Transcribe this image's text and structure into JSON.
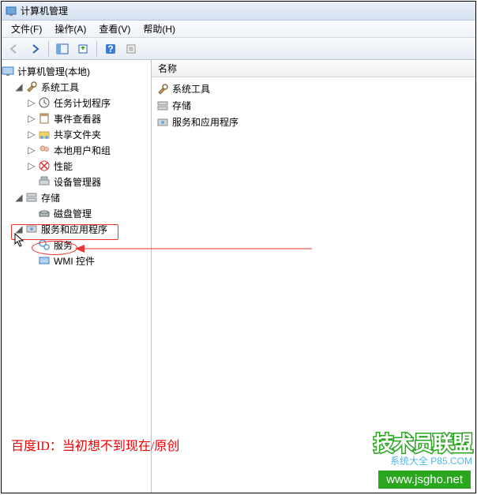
{
  "titlebar": {
    "text": "计算机管理"
  },
  "menu": {
    "file": "文件(F)",
    "action": "操作(A)",
    "view": "查看(V)",
    "help": "帮助(H)"
  },
  "tree": {
    "root": "计算机管理(本地)",
    "sys": "系统工具",
    "sys_children": {
      "sched": "任务计划程序",
      "evt": "事件查看器",
      "shared": "共享文件夹",
      "users": "本地用户和组",
      "perf": "性能",
      "devmgr": "设备管理器"
    },
    "storage": "存储",
    "storage_children": {
      "diskmgmt": "磁盘管理"
    },
    "svcapps": "服务和应用程序",
    "svcapps_children": {
      "services": "服务",
      "wmi": "WMI 控件"
    }
  },
  "right": {
    "header": "名称",
    "items": {
      "sys": "系统工具",
      "storage": "存储",
      "svcapps": "服务和应用程序"
    }
  },
  "annotation": {
    "text": "百度ID：当初想不到现在/原创"
  },
  "overlay": {
    "line1": "技术员联盟",
    "line2": "系统大全  P85.COM",
    "line3": "www.jsgho.net"
  }
}
